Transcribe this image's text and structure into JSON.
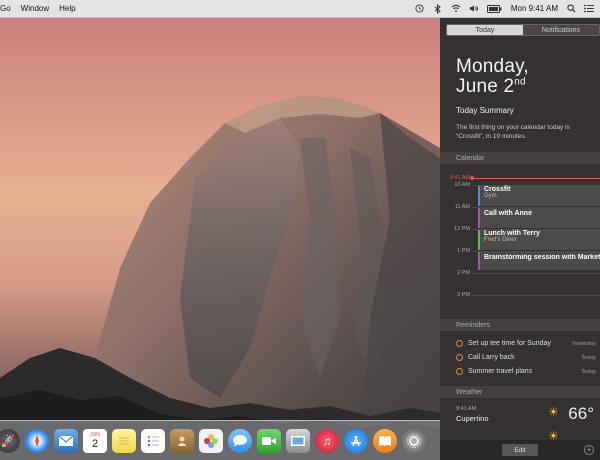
{
  "menubar": {
    "items": [
      "Go",
      "Window",
      "Help"
    ],
    "clock": "Mon 9:41 AM"
  },
  "notification_center": {
    "tabs": [
      "Today",
      "Notifications"
    ],
    "date_line1": "Monday,",
    "date_line2_main": "June 2",
    "date_line2_suffix": "nd",
    "summary_title": "Today Summary",
    "summary_text": "The first thing on your calendar today is “Crossfit”, in 19 minutes.",
    "calendar": {
      "header": "Calendar",
      "now_label": "9:41 AM",
      "hours": [
        "10 AM",
        "11 AM",
        "12 PM",
        "1 PM",
        "2 PM",
        "3 PM"
      ],
      "events": [
        {
          "title": "Crossfit",
          "subtitle": "Gym"
        },
        {
          "title": "Call with Anne",
          "subtitle": ""
        },
        {
          "title": "Lunch with Terry",
          "subtitle": "Fred’s Diner"
        },
        {
          "title": "Brainstorming session with Marketing",
          "subtitle": ""
        }
      ]
    },
    "reminders": {
      "header": "Reminders",
      "items": [
        {
          "text": "Set up tee time for Sunday",
          "when": "Yesterday"
        },
        {
          "text": "Call Larry back",
          "when": "Today"
        },
        {
          "text": "Summer travel plans",
          "when": "Today"
        }
      ]
    },
    "weather": {
      "header": "Weather",
      "time": "9:41 AM",
      "city": "Cupertino",
      "temp": "66°"
    },
    "footer": {
      "edit_label": "Edit"
    }
  },
  "dock": {
    "icons": [
      "launchpad-icon",
      "safari-icon",
      "mail-icon",
      "calendar-icon",
      "notes-icon",
      "reminders-icon",
      "contacts-icon",
      "photos-icon",
      "messages-icon",
      "facetime-icon",
      "preview-icon",
      "itunes-icon",
      "app-store-icon",
      "ibooks-icon",
      "system-preferences-icon"
    ],
    "calendar_month": "JUN",
    "calendar_day": "2"
  },
  "colors": {
    "accent_red": "#e5554f",
    "reminder_orange": "#e58a2f",
    "sun_yellow": "#f4c430"
  }
}
